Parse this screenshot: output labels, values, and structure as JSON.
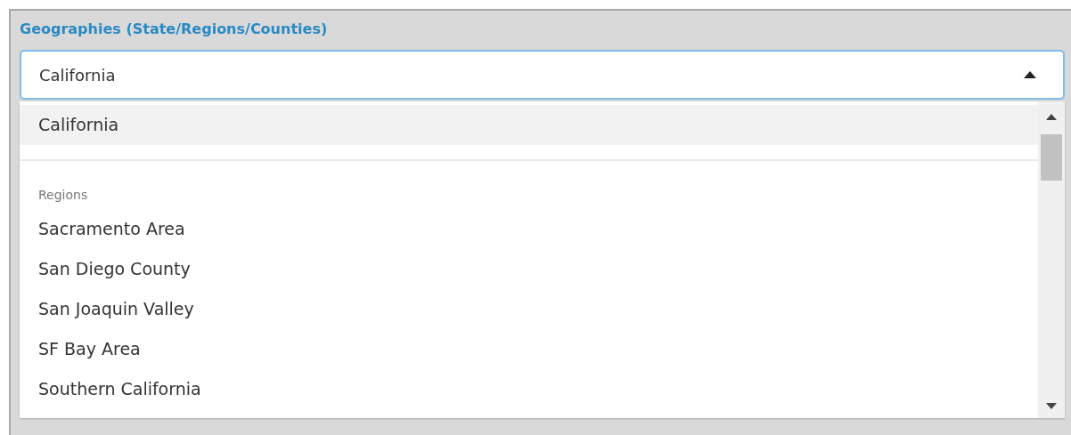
{
  "field": {
    "label": "Geographies (State/Regions/Counties)",
    "value": "California",
    "expanded": true
  },
  "options": [
    {
      "kind": "option",
      "label": "California",
      "selected": true
    },
    {
      "kind": "group",
      "label": "Regions",
      "children": [
        {
          "kind": "option",
          "label": "Sacramento Area",
          "selected": false
        },
        {
          "kind": "option",
          "label": "San Diego County",
          "selected": false
        },
        {
          "kind": "option",
          "label": "San Joaquin Valley",
          "selected": false
        },
        {
          "kind": "option",
          "label": "SF Bay Area",
          "selected": false
        },
        {
          "kind": "option",
          "label": "Southern California",
          "selected": false
        }
      ]
    }
  ]
}
